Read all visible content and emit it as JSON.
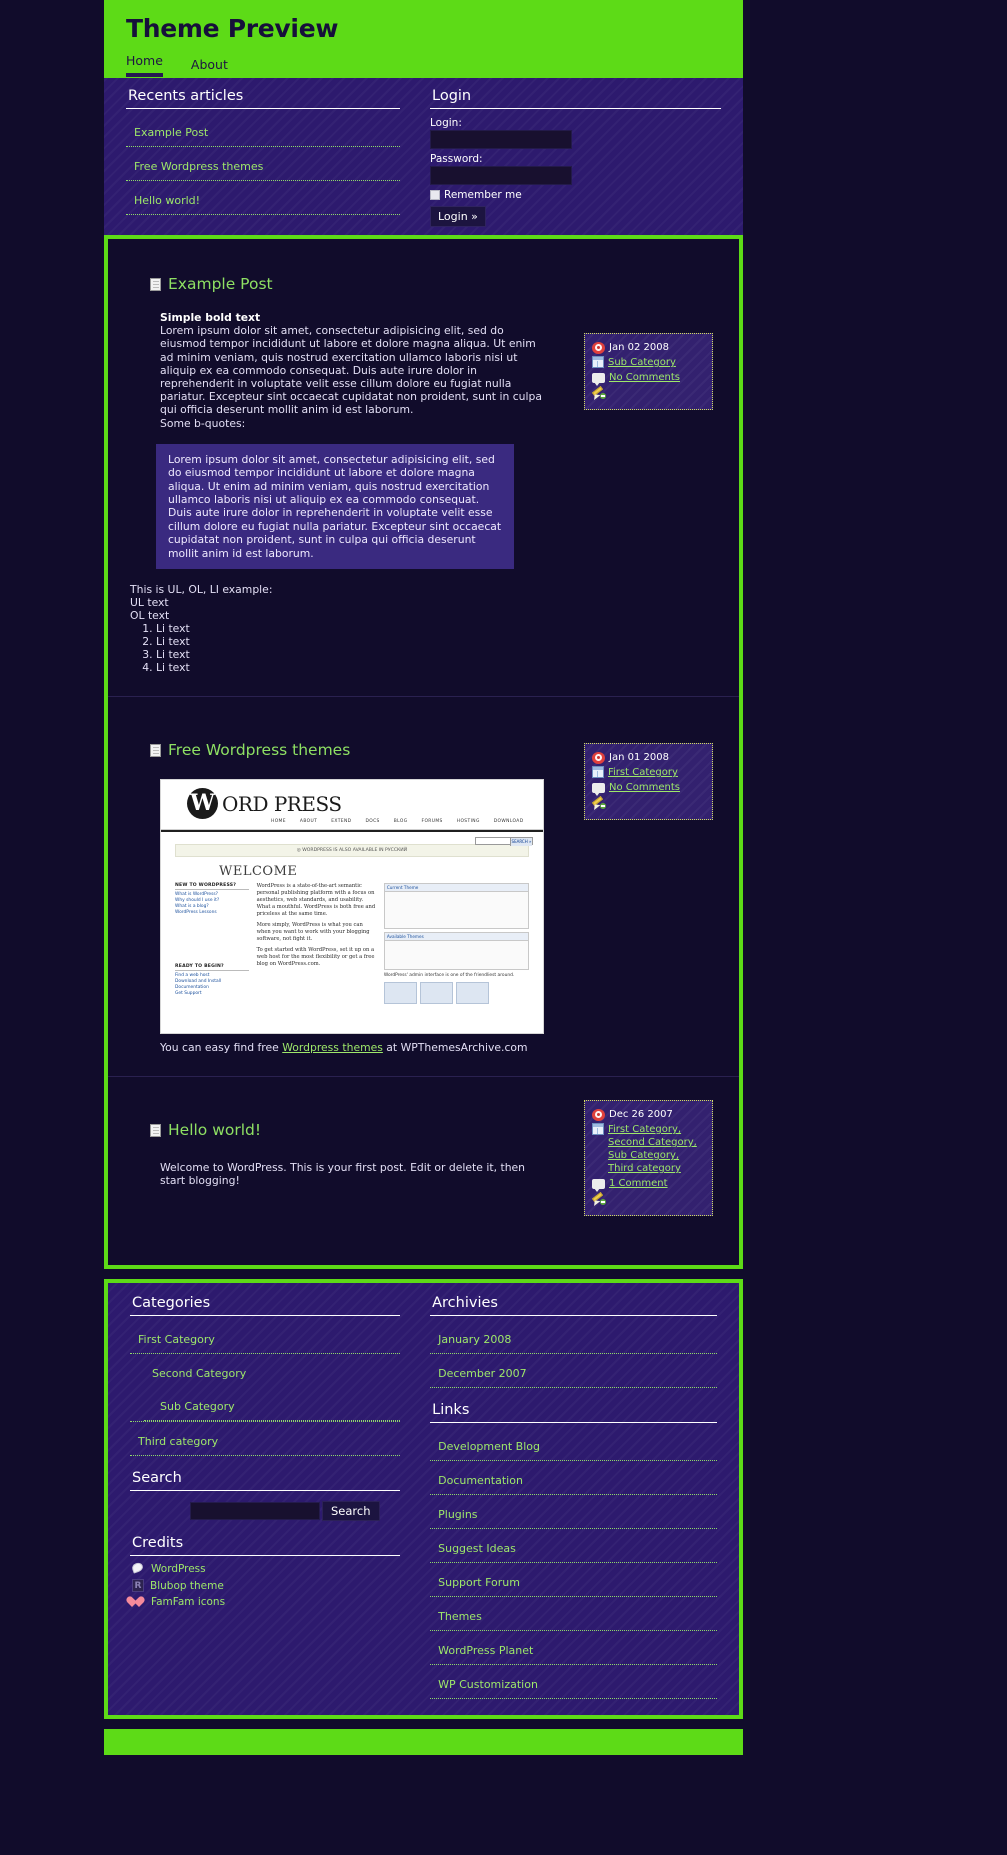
{
  "colors": {
    "accent_green": "#5ddb17",
    "link_green": "#9ee86a",
    "panel_purple": "#2d1a6e",
    "page_bg": "#110c2b",
    "meta_border": "#d3de5e"
  },
  "header": {
    "site_title": "Theme Preview",
    "nav": [
      {
        "label": "Home",
        "current": true
      },
      {
        "label": "About",
        "current": false
      }
    ]
  },
  "topbar": {
    "recents": {
      "title": "Recents articles",
      "items": [
        {
          "label": "Example Post"
        },
        {
          "label": "Free Wordpress themes"
        },
        {
          "label": "Hello world!"
        }
      ]
    },
    "login": {
      "title": "Login",
      "login_label": "Login:",
      "login_value": "",
      "login_placeholder": "",
      "password_label": "Password:",
      "password_value": "",
      "password_placeholder": "",
      "remember_label": "Remember me",
      "remember_checked": false,
      "submit_label": "Login »"
    }
  },
  "posts": [
    {
      "title": "Example Post",
      "icon": "document-icon",
      "lead_bold": "Simple bold text",
      "lead_text": "Lorem ipsum dolor sit amet, consectetur adipisicing elit, sed do eiusmod tempor incididunt ut labore et dolore magna aliqua. Ut enim ad minim veniam, quis nostrud exercitation ullamco laboris nisi ut aliquip ex ea commodo consequat. Duis aute irure dolor in reprehenderit in voluptate velit esse cillum dolore eu fugiat nulla pariatur. Excepteur sint occaecat cupidatat non proident, sunt in culpa qui officia deserunt mollit anim id est laborum.",
      "quote_intro": "Some b-quotes:",
      "blockquote": "Lorem ipsum dolor sit amet, consectetur adipisicing elit, sed do eiusmod tempor incididunt ut labore et dolore magna aliqua. Ut enim ad minim veniam, quis nostrud exercitation ullamco laboris nisi ut aliquip ex ea commodo consequat. Duis aute irure dolor in reprehenderit in voluptate velit esse cillum dolore eu fugiat nulla pariatur. Excepteur sint occaecat cupidatat non proident, sunt in culpa qui officia deserunt mollit anim id est laborum.",
      "list_intro": "This is UL, OL, LI example:",
      "ul_items": [
        "UL text",
        "OL text"
      ],
      "ol_items": [
        "Li text",
        "Li text",
        "Li text",
        "Li text"
      ],
      "meta": {
        "date": "Jan 02 2008",
        "categories_text": "Sub Category",
        "comments_text": "No Comments"
      }
    },
    {
      "title": "Free Wordpress themes",
      "icon": "document-icon",
      "caption_before": "You can easy find free ",
      "caption_link": "Wordpress themes",
      "caption_after": " at WPThemesArchive.com",
      "meta": {
        "date": "Jan 01 2008",
        "categories_text": "First Category",
        "comments_text": "No Comments"
      }
    },
    {
      "title": "Hello world!",
      "icon": "document-icon",
      "body": "Welcome to WordPress. This is your first post. Edit or delete it, then start blogging!",
      "meta": {
        "date": "Dec 26 2007",
        "categories_text": "First Category, Second Category, Sub Category, Third category",
        "comments_text": "1 Comment"
      }
    }
  ],
  "wp_screenshot": {
    "logo_letter": "W",
    "logo_text": "ORD PRESS",
    "nav": [
      "HOME",
      "ABOUT",
      "EXTEND",
      "DOCS",
      "BLOG",
      "FORUMS",
      "HOSTING",
      "DOWNLOAD"
    ],
    "search_button": "SEARCH »",
    "notice": "◎ WORDPRESS IS ALSO AVAILABLE IN РУССКИЙ",
    "welcome": "WELCOME",
    "col1_h1": "NEW TO WORDPRESS?",
    "col1_items": [
      "What is WordPress?",
      "Why should I use it?",
      "What is a blog?",
      "WordPress Lessons"
    ],
    "col1_h2": "READY TO BEGIN?",
    "col1_items2": [
      "Find a web host",
      "Download and Install",
      "Documentation",
      "Get Support"
    ],
    "col2_lead": "WordPress is a state-of-the-art semantic personal publishing platform with a focus on aesthetics, web standards, and usability. What a mouthful. WordPress is both free and priceless at the same time.",
    "col2_p2": "More simply, WordPress is what you can when you want to work with your blogging software, not fight it.",
    "col2_p3": "To get started with WordPress, set it up on a web host for the most flexibility or get a free blog on WordPress.com.",
    "col3_h": "Current Theme",
    "col3_h2": "Available Themes",
    "col3_cap": "WordPress' admin interface is one of the friendliest around."
  },
  "footer": {
    "categories": {
      "title": "Categories",
      "items": [
        {
          "label": "First Category",
          "sub": false
        },
        {
          "label": "Second Category",
          "sub": false
        },
        {
          "label": "Sub Category",
          "sub": true
        },
        {
          "label": "Third category",
          "sub": false
        }
      ]
    },
    "search": {
      "title": "Search",
      "value": "",
      "placeholder": "",
      "button_label": "Search"
    },
    "credits": {
      "title": "Credits",
      "items": [
        {
          "label": "WordPress",
          "icon": "wordpress-icon"
        },
        {
          "label": "Blubop theme",
          "icon": "blubop-icon"
        },
        {
          "label": "FamFam icons",
          "icon": "heart-icon"
        }
      ]
    },
    "archives": {
      "title": "Archivies",
      "items": [
        {
          "label": "January 2008"
        },
        {
          "label": "December 2007"
        }
      ]
    },
    "links": {
      "title": "Links",
      "items": [
        {
          "label": "Development Blog"
        },
        {
          "label": "Documentation"
        },
        {
          "label": "Plugins"
        },
        {
          "label": "Suggest Ideas"
        },
        {
          "label": "Support Forum"
        },
        {
          "label": "Themes"
        },
        {
          "label": "WordPress Planet"
        },
        {
          "label": "WP Customization"
        }
      ]
    }
  }
}
